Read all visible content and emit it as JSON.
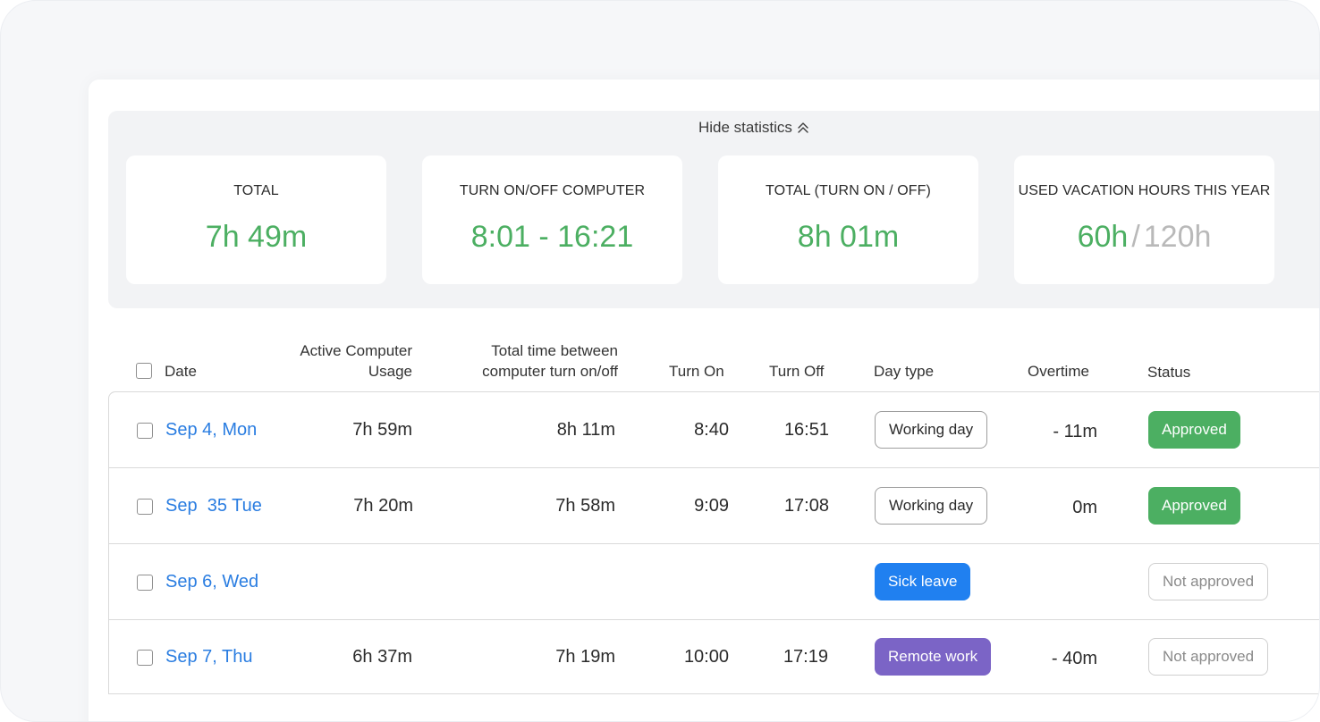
{
  "statistics": {
    "toggle_label": "Hide statistics",
    "cards": [
      {
        "label": "TOTAL",
        "value": "7h 49m"
      },
      {
        "label": "TURN ON/OFF COMPUTER",
        "value": "8:01 - 16:21"
      },
      {
        "label": "TOTAL (TURN ON / OFF)",
        "value": "8h 01m"
      },
      {
        "label": "USED VACATION HOURS THIS YEAR",
        "used": "60h",
        "separator": "/",
        "total": "120h"
      }
    ]
  },
  "table": {
    "headers": {
      "date": "Date",
      "active_line1": "Active Computer",
      "active_line2": "Usage",
      "between_line1": "Total time between",
      "between_line2": "computer turn on/off",
      "turn_on": "Turn On",
      "turn_off": "Turn Off",
      "day_type": "Day type",
      "overtime": "Overtime",
      "status": "Status"
    },
    "rows": [
      {
        "date": "Sep 4, Mon",
        "active": "7h 59m",
        "between": "8h 11m",
        "turn_on": "8:40",
        "turn_off": "16:51",
        "day_type": "Working day",
        "overtime": "- 11m",
        "status": "Approved"
      },
      {
        "date": "Sep  35 Tue",
        "active": "7h 20m",
        "between": "7h 58m",
        "turn_on": "9:09",
        "turn_off": "17:08",
        "day_type": "Working day",
        "overtime": "0m",
        "status": "Approved"
      },
      {
        "date": "Sep 6, Wed",
        "active": "",
        "between": "",
        "turn_on": "",
        "turn_off": "",
        "day_type": "Sick leave",
        "overtime": "",
        "status": "Not approved"
      },
      {
        "date": "Sep 7, Thu",
        "active": "6h 37m",
        "between": "7h 19m",
        "turn_on": "10:00",
        "turn_off": "17:19",
        "day_type": "Remote work",
        "overtime": "- 40m",
        "status": "Not approved"
      }
    ]
  },
  "colors": {
    "accent_green": "#4caf62",
    "link_blue": "#2a7de1",
    "sick_leave": "#2080f0",
    "remote_work": "#7b64c6"
  },
  "icons": {
    "toggle": "double-chevron-up-icon"
  }
}
